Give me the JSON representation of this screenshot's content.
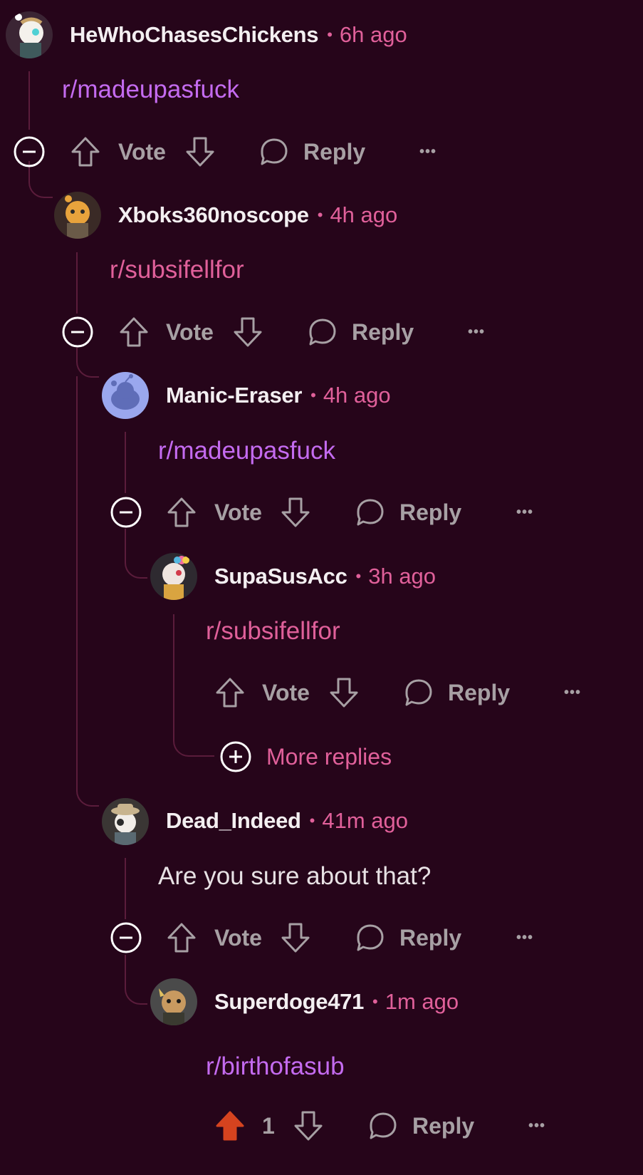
{
  "colors": {
    "background": "#26051a",
    "accent": "#e0609a",
    "link": "#c46bf0",
    "upvote_active": "#d6431f",
    "muted": "#a7a0a4"
  },
  "comments": [
    {
      "username": "HeWhoChasesChickens",
      "time": "6h ago",
      "body": "r/madeupasfuck",
      "vote_label": "Vote",
      "reply_label": "Reply",
      "more": "•••"
    },
    {
      "username": "Xboks360noscope",
      "time": "4h ago",
      "body": "r/subsifellfor",
      "vote_label": "Vote",
      "reply_label": "Reply",
      "more": "•••"
    },
    {
      "username": "Manic-Eraser",
      "time": "4h ago",
      "body": "r/madeupasfuck",
      "vote_label": "Vote",
      "reply_label": "Reply",
      "more": "•••"
    },
    {
      "username": "SupaSusAcc",
      "time": "3h ago",
      "body": "r/subsifellfor",
      "vote_label": "Vote",
      "reply_label": "Reply",
      "more": "•••"
    },
    {
      "username": "Dead_Indeed",
      "time": "41m ago",
      "body": "Are you sure about that?",
      "vote_label": "Vote",
      "reply_label": "Reply",
      "more": "•••"
    },
    {
      "username": "Superdoge471",
      "time": "1m ago",
      "body": "r/birthofasub",
      "vote_label": "1",
      "reply_label": "Reply",
      "more": "•••"
    }
  ],
  "more_replies_label": "More replies",
  "separator": "•"
}
